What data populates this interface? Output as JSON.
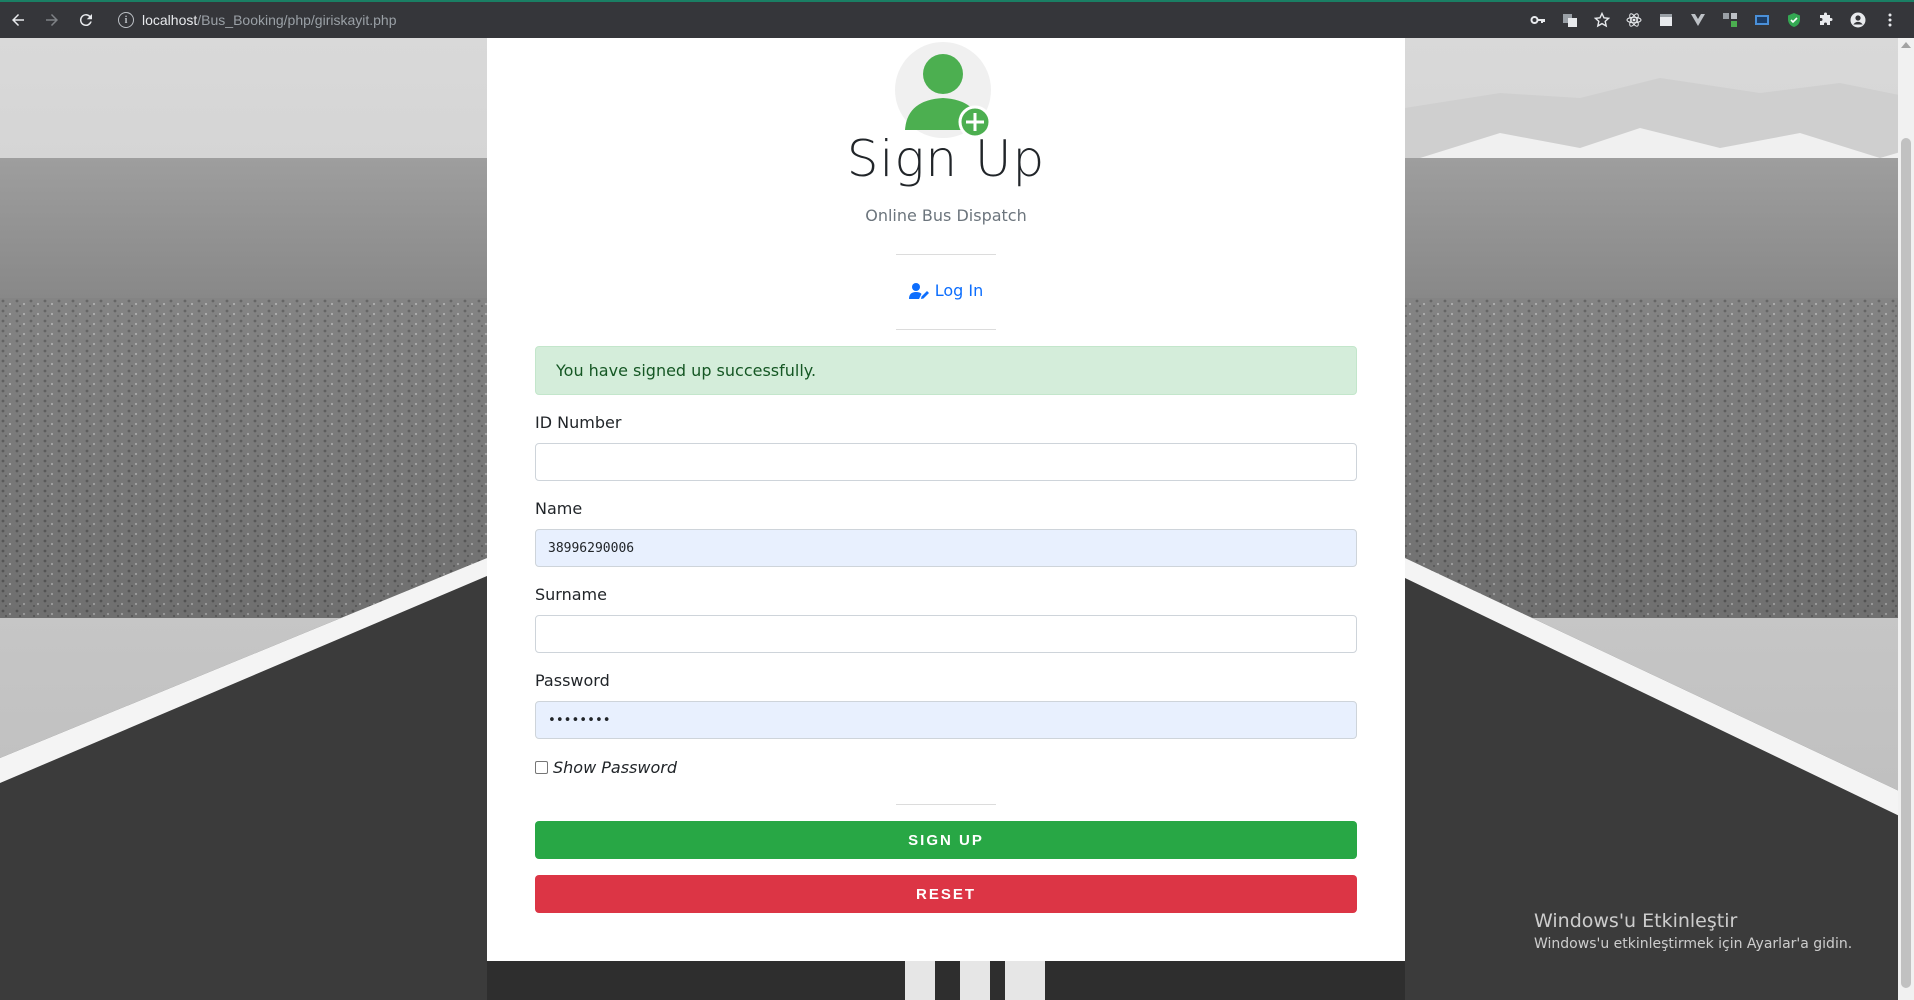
{
  "browser": {
    "url_host": "localhost",
    "url_path": "/Bus_Booking/php/giriskayit.php"
  },
  "card": {
    "title": "Sign Up",
    "subtitle": "Online Bus Dispatch",
    "login_link": "Log In",
    "alert": "You have signed up successfully.",
    "fields": {
      "id_number": {
        "label": "ID Number",
        "value": ""
      },
      "name": {
        "label": "Name",
        "value": "38996290006"
      },
      "surname": {
        "label": "Surname",
        "value": ""
      },
      "password": {
        "label": "Password",
        "value": "••••••••"
      }
    },
    "show_password": "Show Password",
    "signup_button": "SIGN UP",
    "reset_button": "RESET"
  },
  "watermark": {
    "line1": "Windows'u Etkinleştir",
    "line2": "Windows'u etkinleştirmek için Ayarlar'a gidin."
  },
  "colors": {
    "success": "#28a745",
    "danger": "#dc3545",
    "link": "#0d6efd",
    "avatar": "#4caf50"
  }
}
